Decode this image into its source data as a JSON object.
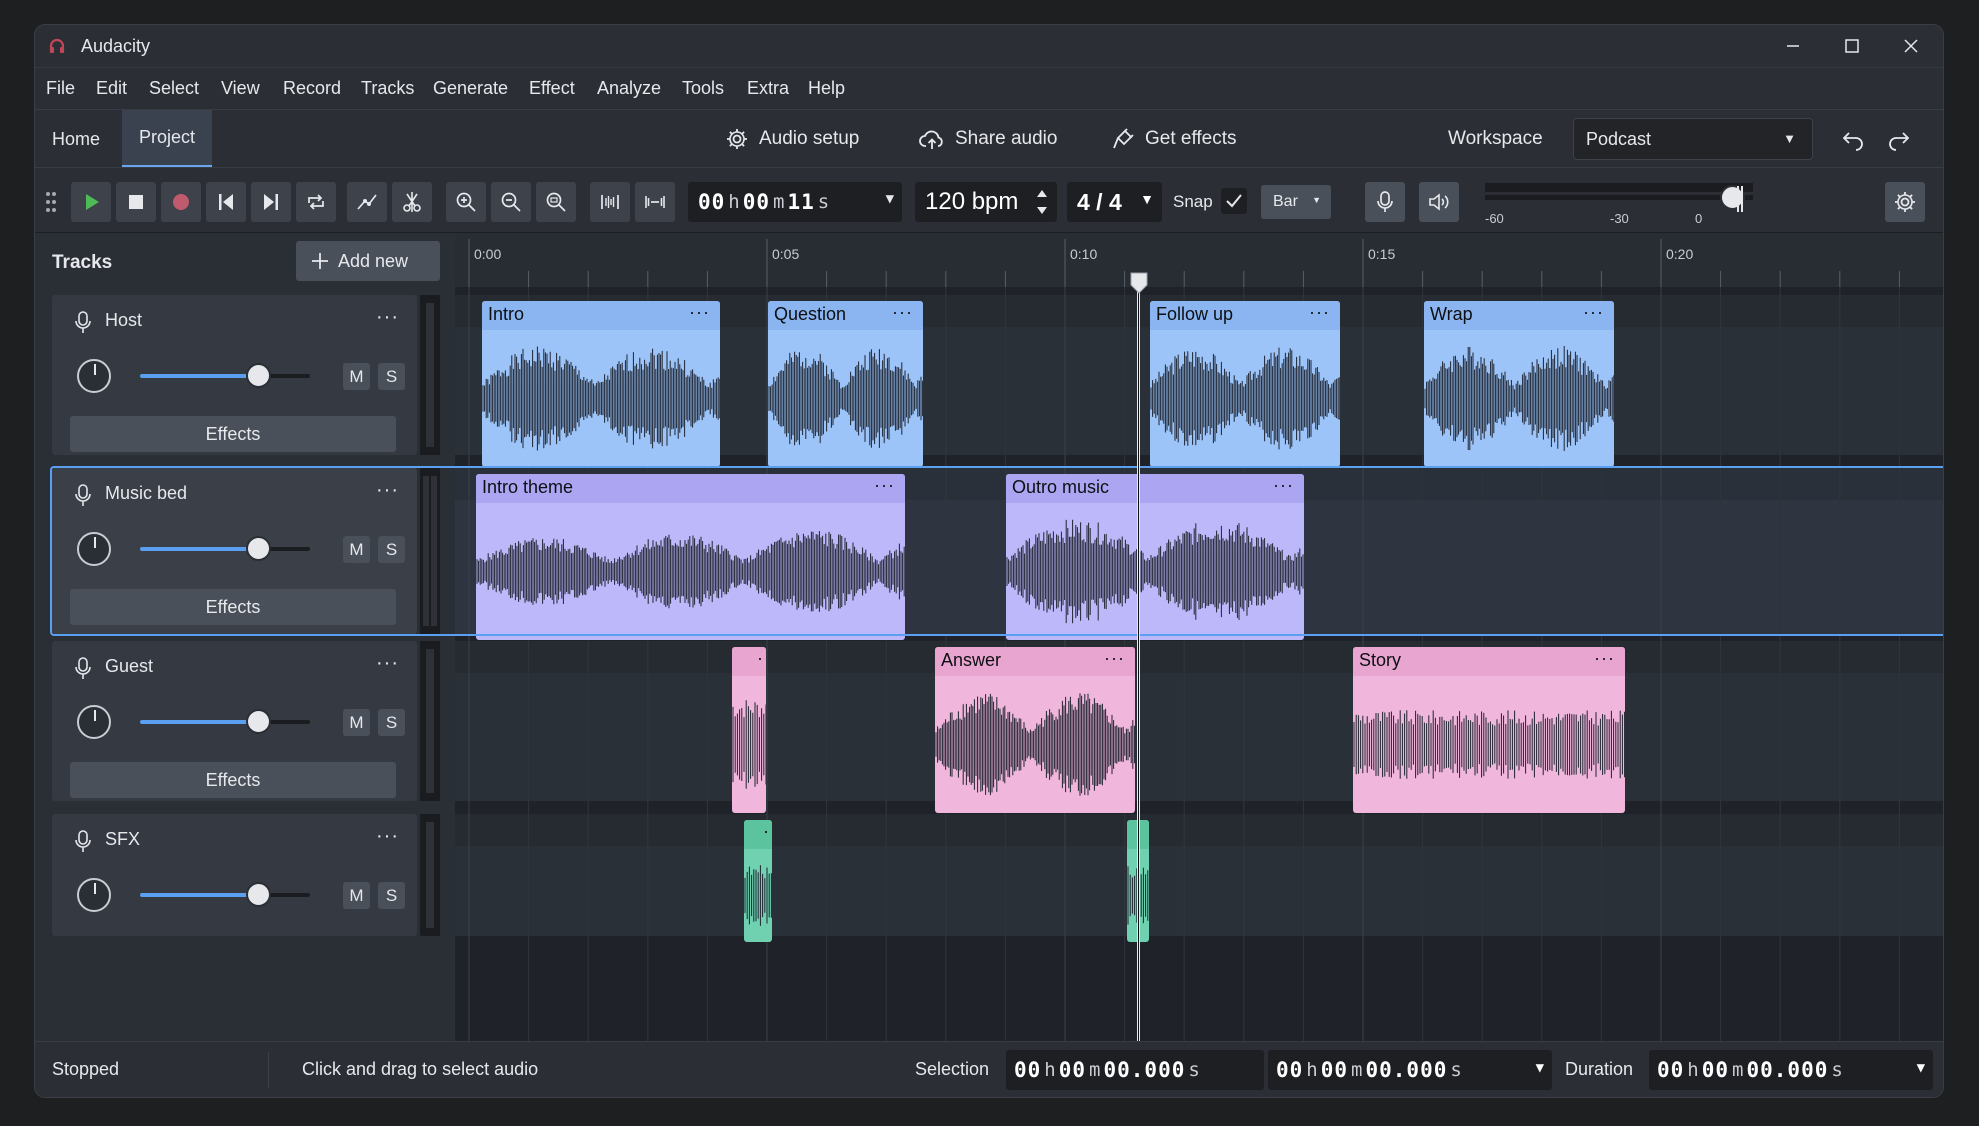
{
  "window": {
    "title": "Audacity"
  },
  "menu": [
    "File",
    "Edit",
    "Select",
    "View",
    "Record",
    "Tracks",
    "Generate",
    "Effect",
    "Analyze",
    "Tools",
    "Extra",
    "Help"
  ],
  "tabs": {
    "home": "Home",
    "project": "Project"
  },
  "header": {
    "audio_setup": "Audio setup",
    "share_audio": "Share audio",
    "get_effects": "Get effects",
    "workspace_label": "Workspace",
    "workspace_value": "Podcast"
  },
  "toolbar": {
    "time": {
      "h": "00",
      "m": "00",
      "s": "11",
      "h_unit": "h",
      "m_unit": "m",
      "s_unit": "s"
    },
    "tempo": "120 bpm",
    "time_signature": "4 / 4",
    "snap_label": "Snap",
    "snap_checked": true,
    "snap_value": "Bar",
    "meter_ticks": [
      "-60",
      "-30",
      "0"
    ],
    "meter_level": 0.0
  },
  "panel": {
    "title": "Tracks",
    "add_new": "Add new"
  },
  "tracks": [
    {
      "name": "Host",
      "volume": 0.71,
      "mute": "M",
      "solo": "S",
      "effects": "Effects",
      "selected": false
    },
    {
      "name": "Music bed",
      "volume": 0.71,
      "mute": "M",
      "solo": "S",
      "effects": "Effects",
      "selected": true
    },
    {
      "name": "Guest",
      "volume": 0.71,
      "mute": "M",
      "solo": "S",
      "effects": "Effects",
      "selected": false
    },
    {
      "name": "SFX",
      "volume": 0.71,
      "mute": "M",
      "solo": "S",
      "effects": null,
      "selected": false
    }
  ],
  "ruler": {
    "labels": [
      "0:00",
      "0:05",
      "0:10",
      "0:15",
      "0:20"
    ]
  },
  "clips": {
    "host": [
      "Intro",
      "Question",
      "Follow up",
      "Wrap"
    ],
    "music": [
      "Intro theme",
      "Outro music"
    ],
    "guest": [
      "",
      "Answer",
      "Story"
    ],
    "sfx": [
      "",
      ""
    ]
  },
  "colors": {
    "host": "#9cc4f8",
    "host_header": "#8ab5f0",
    "music": "#bdb8fa",
    "music_header": "#aba5f2",
    "guest": "#f0b6dc",
    "guest_header": "#e8a5d0",
    "sfx": "#6fd1b0",
    "accent": "#5a9ff0",
    "play": "#4fbb56"
  },
  "status": {
    "state": "Stopped",
    "hint": "Click and drag to select audio",
    "selection_label": "Selection",
    "selection_start": {
      "h": "00",
      "m": "00",
      "s": "00.000"
    },
    "selection_end": {
      "h": "00",
      "m": "00",
      "s": "00.000"
    },
    "duration_label": "Duration",
    "duration": {
      "h": "00",
      "m": "00",
      "s": "00.000"
    },
    "units": {
      "h": "h",
      "m": "m",
      "s": "s"
    }
  }
}
